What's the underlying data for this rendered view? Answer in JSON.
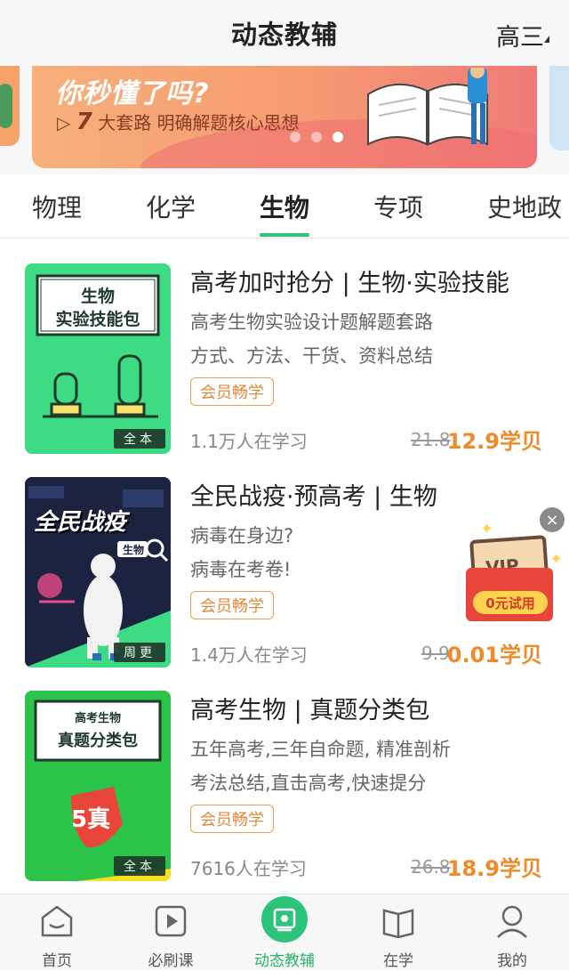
{
  "header": {
    "title": "动态教辅",
    "grade": "高三"
  },
  "banner": {
    "headline": "你秒懂了吗?",
    "sub_num": "7",
    "sub_text": "大套路 明确解题核心思想",
    "slides": 3,
    "active_slide": 3
  },
  "tabs": [
    "物理",
    "化学",
    "生物",
    "专项",
    "史地政"
  ],
  "active_tab": "生物",
  "courses": [
    {
      "cover_line1": "生物",
      "cover_line2": "实验技能包",
      "cover_tag": "全本",
      "title": "高考加时抢分 | 生物·实验技能",
      "desc1": "高考生物实验设计题解题套路",
      "desc2": "方式、方法、干货、资料总结",
      "badge": "会员畅学",
      "learners": "1.1万人在学习",
      "orig_price": "21.8",
      "price": "12.9学贝"
    },
    {
      "cover_line1": "全民战疫",
      "cover_line2": "生物",
      "cover_tag": "周更",
      "title": "全民战疫·预高考 | 生物",
      "desc1": "病毒在身边?",
      "desc2": "病毒在考卷!",
      "badge": "会员畅学",
      "learners": "1.4万人在学习",
      "orig_price": "9.9",
      "price": "0.01学贝"
    },
    {
      "cover_line1": "高考生物",
      "cover_line2": "真题分类包",
      "cover_stamp_num": "5",
      "cover_stamp_text": "真",
      "cover_tag": "全本",
      "title": "高考生物 | 真题分类包",
      "desc1": "五年高考,三年自命题, 精准剖析",
      "desc2": "考法总结,直击高考,快速提分",
      "badge": "会员畅学",
      "learners": "7616人在学习",
      "orig_price": "26.8",
      "price": "18.9学贝"
    }
  ],
  "vip_popup": {
    "vip_text": "VIP",
    "button": "0元试用",
    "close": "×"
  },
  "bottom_nav": [
    {
      "label": "首页",
      "icon": "home-icon"
    },
    {
      "label": "必刷课",
      "icon": "play-icon"
    },
    {
      "label": "动态教辅",
      "icon": "tutoring-icon"
    },
    {
      "label": "在学",
      "icon": "book-icon"
    },
    {
      "label": "我的",
      "icon": "profile-icon"
    }
  ],
  "active_nav": "动态教辅",
  "colors": {
    "accent": "#2cc37a",
    "price": "#f08a2c",
    "badge": "#e08a3c"
  }
}
